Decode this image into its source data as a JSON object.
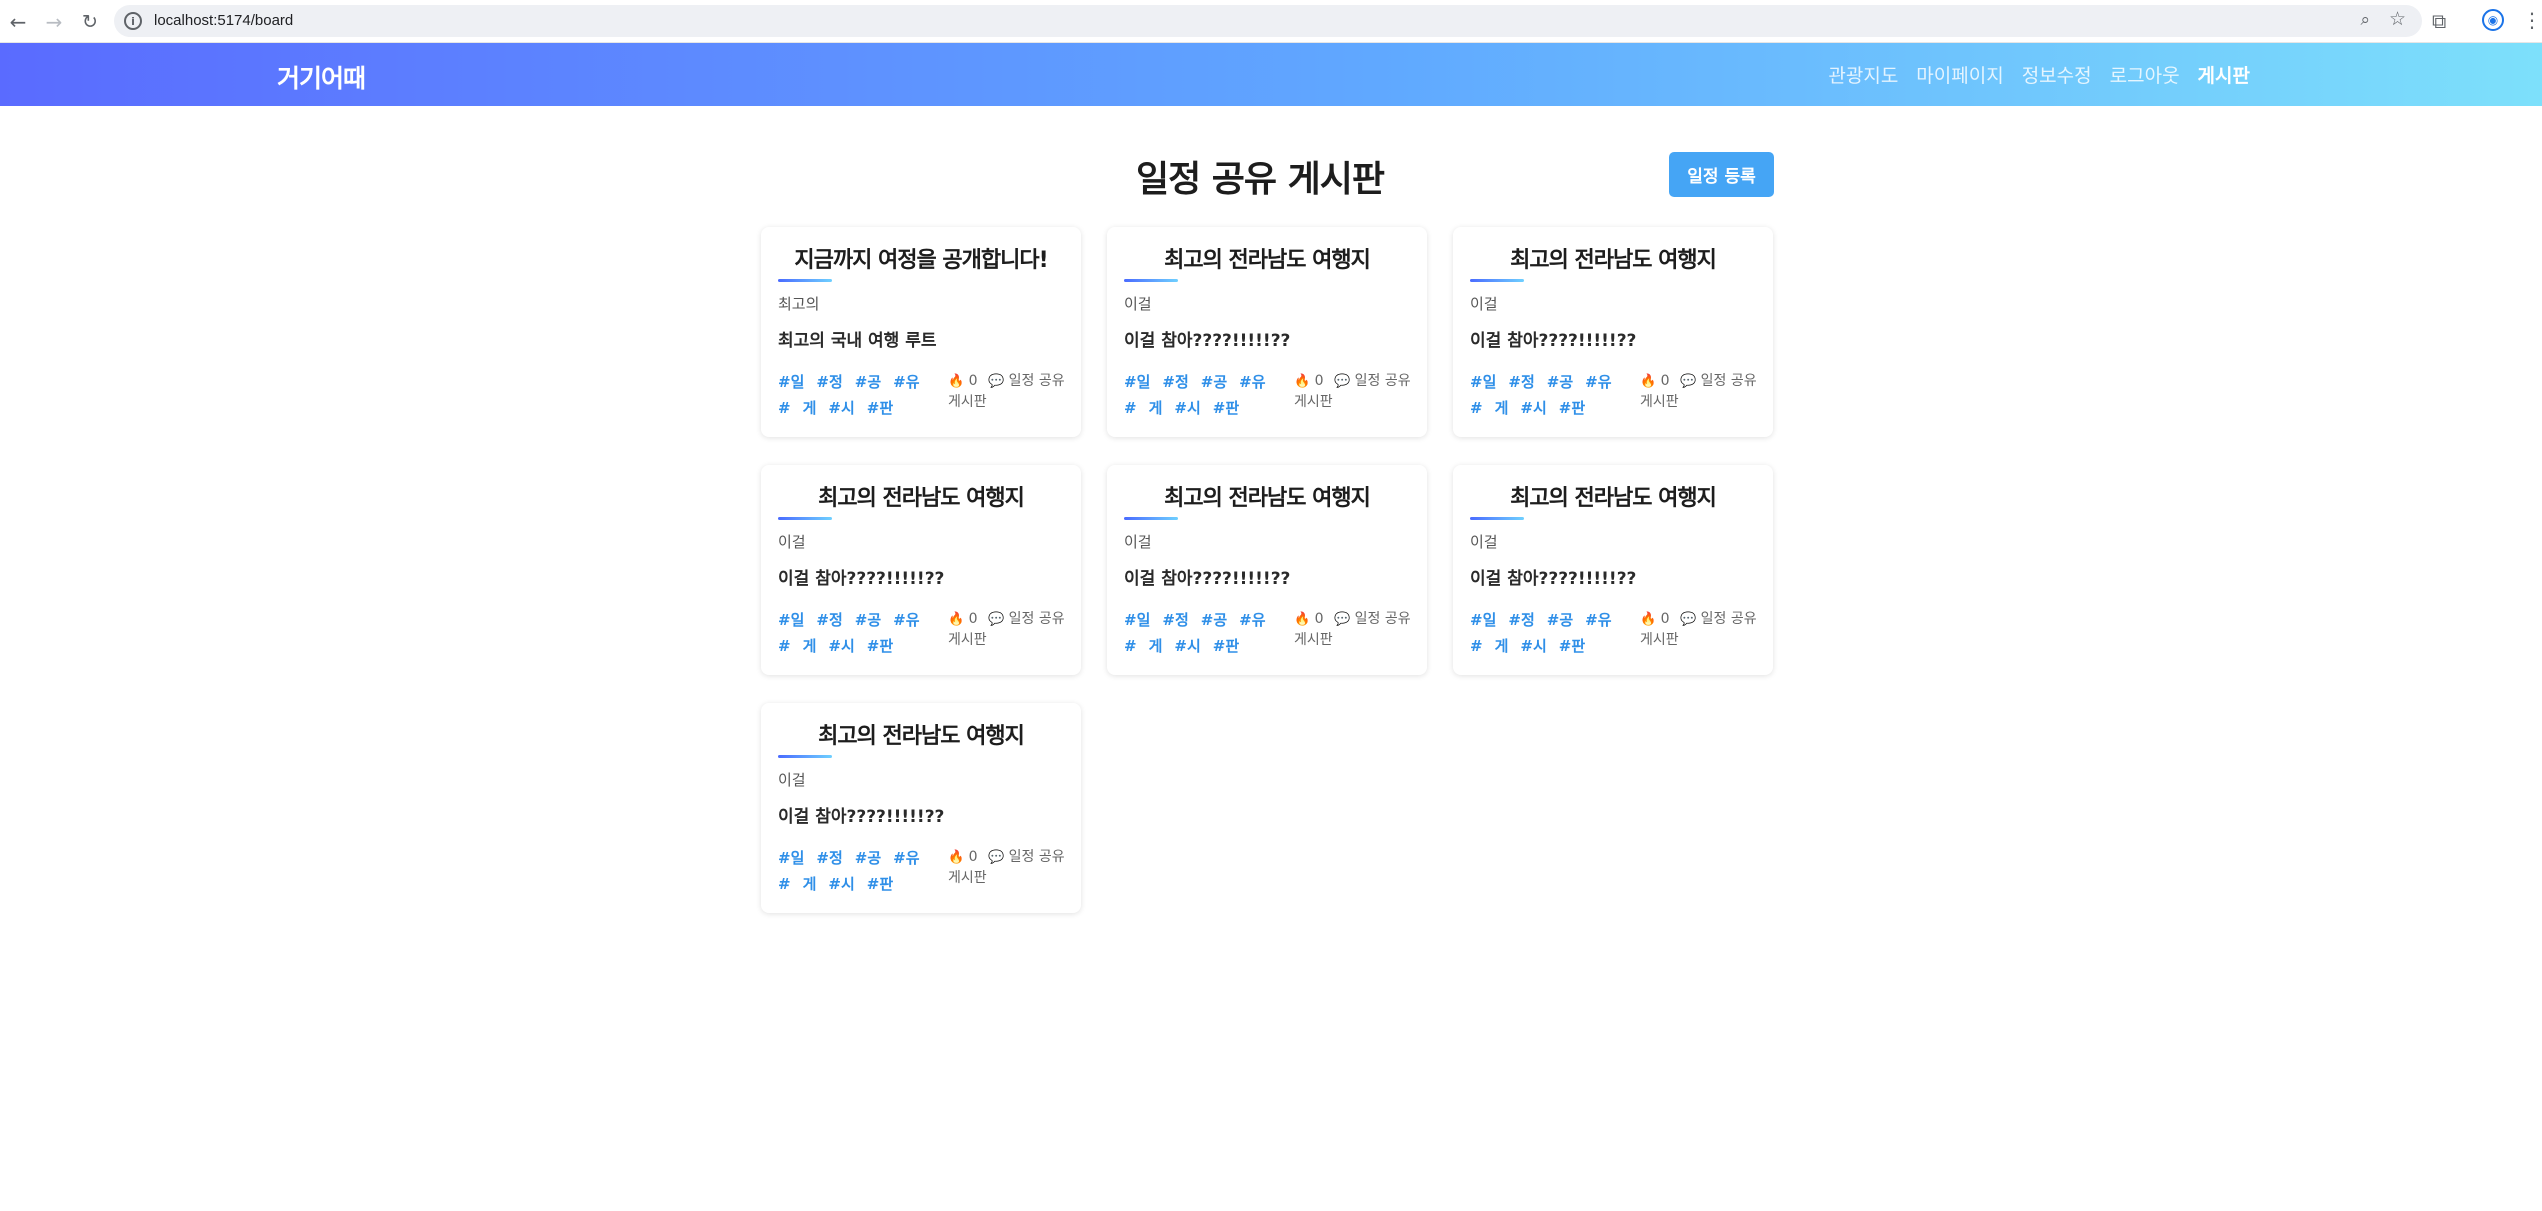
{
  "browser": {
    "url": "localhost:5174/board",
    "back_icon": "←",
    "forward_icon": "→",
    "reload_icon": "↻",
    "info_icon": "i",
    "zoom_icon": "⌕",
    "star_icon": "☆",
    "extension_icon": "⧉",
    "profile_icon": "◉",
    "menu_icon": "⋮"
  },
  "header": {
    "logo": "거기어때",
    "nav": [
      "관광지도",
      "마이페이지",
      "정보수정",
      "로그아웃",
      "게시판"
    ],
    "active_nav": "게시판"
  },
  "page": {
    "title": "일정 공유 게시판",
    "register_button": "일정 등록"
  },
  "cards": [
    {
      "title": "지금까지 여정을 공개합니다!",
      "subtitle": "최고의",
      "description": "최고의 국내 여행 루트",
      "tags": [
        "#일",
        "#정",
        "#공",
        "#유",
        "#",
        "게",
        "#시",
        "#판"
      ],
      "like_icon": "🔥",
      "likes": "0",
      "comment_icon": "💬",
      "category": "일정 공유게시판"
    },
    {
      "title": "최고의 전라남도 여행지",
      "subtitle": "이걸",
      "description": "이걸 참아????!!!!!??",
      "tags": [
        "#일",
        "#정",
        "#공",
        "#유",
        "#",
        "게",
        "#시",
        "#판"
      ],
      "like_icon": "🔥",
      "likes": "0",
      "comment_icon": "💬",
      "category": "일정 공유게시판"
    },
    {
      "title": "최고의 전라남도 여행지",
      "subtitle": "이걸",
      "description": "이걸 참아????!!!!!??",
      "tags": [
        "#일",
        "#정",
        "#공",
        "#유",
        "#",
        "게",
        "#시",
        "#판"
      ],
      "like_icon": "🔥",
      "likes": "0",
      "comment_icon": "💬",
      "category": "일정 공유게시판"
    },
    {
      "title": "최고의 전라남도 여행지",
      "subtitle": "이걸",
      "description": "이걸 참아????!!!!!??",
      "tags": [
        "#일",
        "#정",
        "#공",
        "#유",
        "#",
        "게",
        "#시",
        "#판"
      ],
      "like_icon": "🔥",
      "likes": "0",
      "comment_icon": "💬",
      "category": "일정 공유게시판"
    },
    {
      "title": "최고의 전라남도 여행지",
      "subtitle": "이걸",
      "description": "이걸 참아????!!!!!??",
      "tags": [
        "#일",
        "#정",
        "#공",
        "#유",
        "#",
        "게",
        "#시",
        "#판"
      ],
      "like_icon": "🔥",
      "likes": "0",
      "comment_icon": "💬",
      "category": "일정 공유게시판"
    },
    {
      "title": "최고의 전라남도 여행지",
      "subtitle": "이걸",
      "description": "이걸 참아????!!!!!??",
      "tags": [
        "#일",
        "#정",
        "#공",
        "#유",
        "#",
        "게",
        "#시",
        "#판"
      ],
      "like_icon": "🔥",
      "likes": "0",
      "comment_icon": "💬",
      "category": "일정 공유게시판"
    },
    {
      "title": "최고의 전라남도 여행지",
      "subtitle": "이걸",
      "description": "이걸 참아????!!!!!??",
      "tags": [
        "#일",
        "#정",
        "#공",
        "#유",
        "#",
        "게",
        "#시",
        "#판"
      ],
      "like_icon": "🔥",
      "likes": "0",
      "comment_icon": "💬",
      "category": "일정 공유게시판"
    }
  ],
  "colors": {
    "header_gradient_start": "#5a6bff",
    "header_gradient_end": "#7de0fb",
    "accent_blue": "#45a5f5",
    "tag_blue": "#2f8fe8"
  }
}
